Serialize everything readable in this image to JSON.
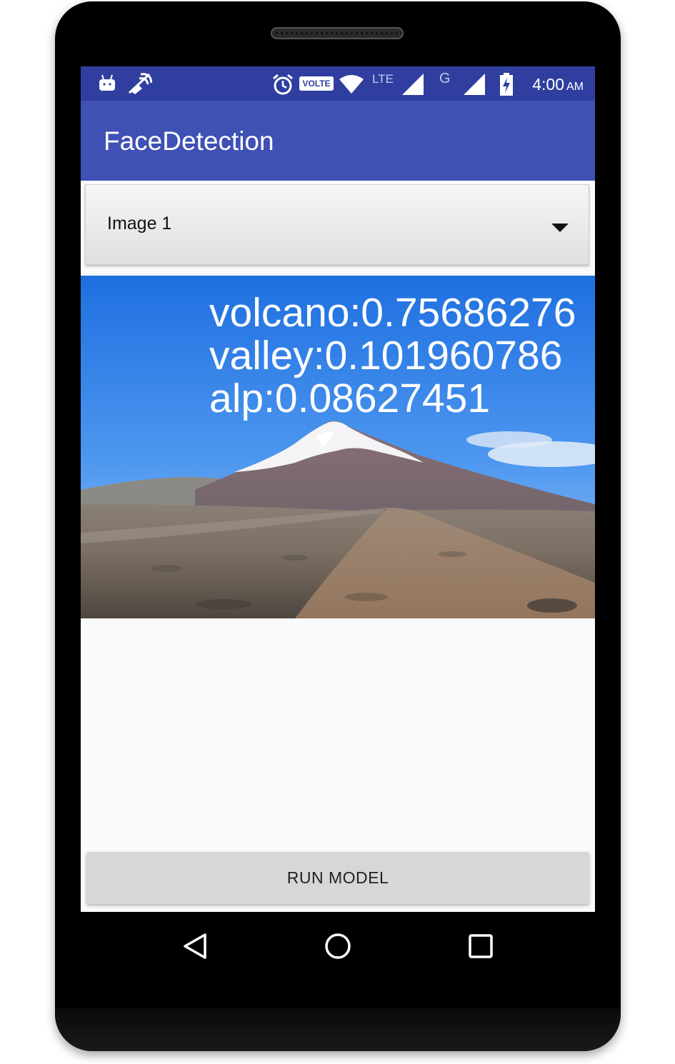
{
  "status_bar": {
    "volte_label": "VOLTE",
    "lte_label": "LTE",
    "g_label": "G",
    "time": "4:00",
    "ampm": "AM"
  },
  "app_bar": {
    "title": "FaceDetection"
  },
  "spinner": {
    "selected": "Image 1"
  },
  "predictions": [
    "volcano:0.75686276",
    "valley:0.101960786",
    "alp:0.08627451"
  ],
  "run_button": {
    "label": "RUN MODEL"
  },
  "nav": {
    "back": "back-icon",
    "home": "home-icon",
    "recents": "recents-icon"
  },
  "colors": {
    "status_bar": "#303f9f",
    "app_bar": "#3f51b5",
    "button": "#d6d7d7"
  }
}
